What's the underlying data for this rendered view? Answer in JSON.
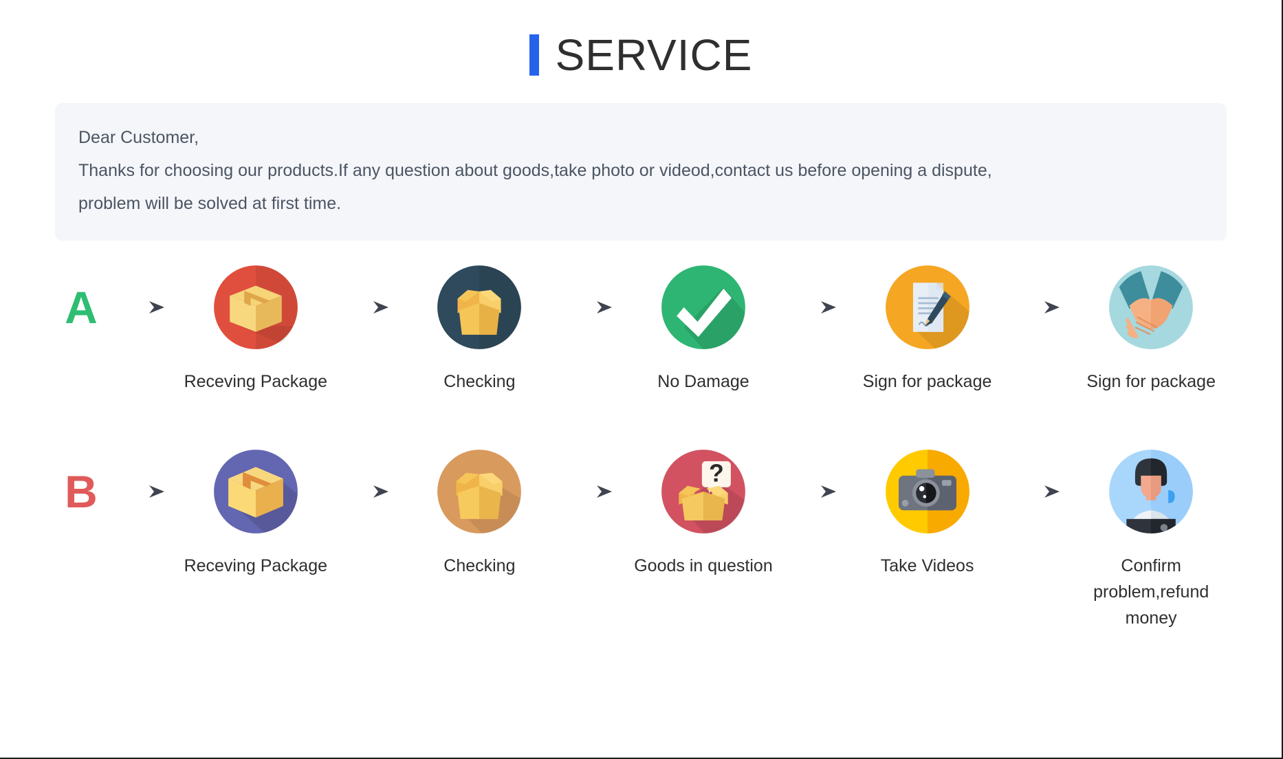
{
  "header": {
    "accent_color": "#2563eb",
    "title": "SERVICE"
  },
  "notice": {
    "line1": "Dear Customer,",
    "line2": "Thanks for choosing our products.If any question about goods,take photo or videod,contact us before opening a dispute,",
    "line3": "problem will be solved at first time.",
    "background_color": "#f5f6fa"
  },
  "flows": [
    {
      "badge": "A",
      "badge_color": "#2fbd72",
      "steps": [
        {
          "label": "Receving Package",
          "icon": "sealed-package-icon",
          "circle_color": "#e04f3d"
        },
        {
          "label": "Checking",
          "icon": "open-box-icon",
          "circle_color": "#2e4a5c"
        },
        {
          "label": "No Damage",
          "icon": "check-mark-icon",
          "circle_color": "#2fb573"
        },
        {
          "label": "Sign for package",
          "icon": "document-sign-icon",
          "circle_color": "#f5a623"
        },
        {
          "label": "Sign for package",
          "icon": "handshake-icon",
          "circle_color": "#a5d8df"
        }
      ]
    },
    {
      "badge": "B",
      "badge_color": "#e05a5a",
      "steps": [
        {
          "label": "Receving Package",
          "icon": "sealed-package-icon",
          "circle_color": "#6366b0"
        },
        {
          "label": "Checking",
          "icon": "open-box-icon",
          "circle_color": "#d99a5e"
        },
        {
          "label": "Goods in question",
          "icon": "question-box-icon",
          "circle_color": "#d25261"
        },
        {
          "label": "Take Videos",
          "icon": "camera-icon",
          "circle_color": "#ffca00"
        },
        {
          "label": "Confirm problem,refund money",
          "icon": "support-agent-icon",
          "circle_color": "#a9d6fb"
        }
      ]
    }
  ],
  "arrow": {
    "name": "arrow-right-icon",
    "color": "#3f4450"
  }
}
